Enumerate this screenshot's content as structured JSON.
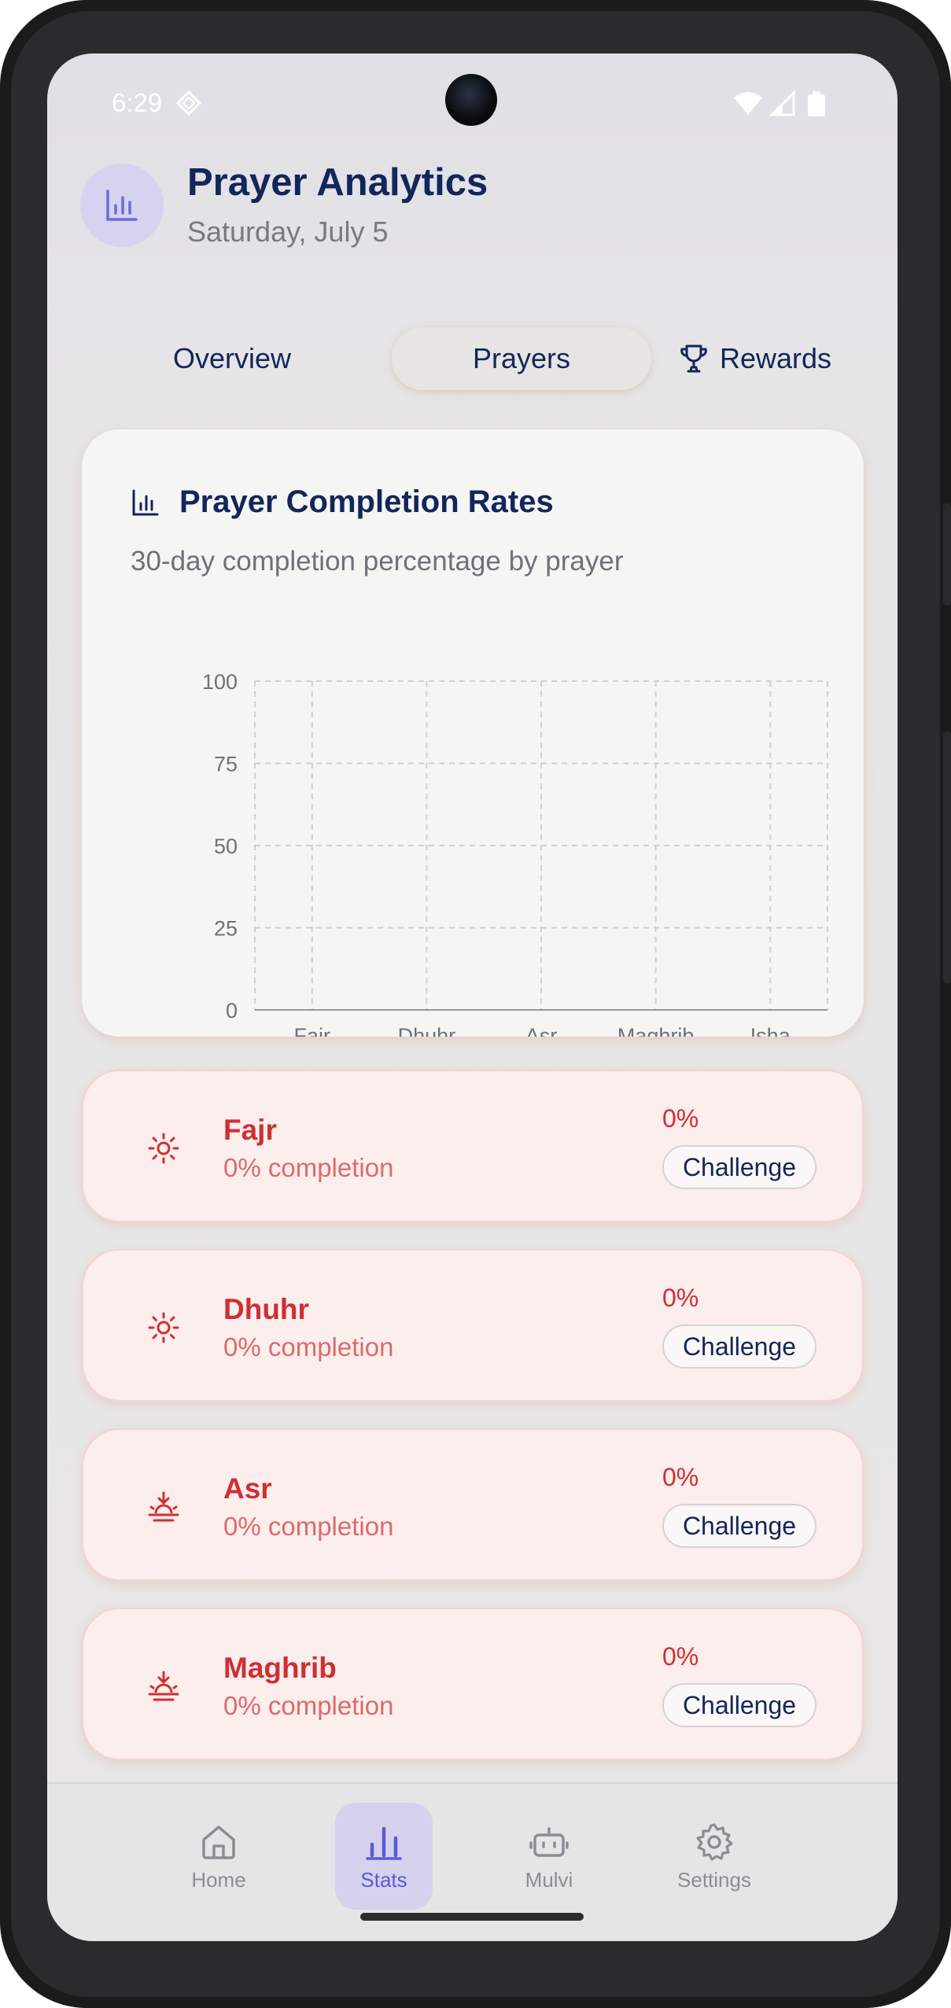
{
  "status_bar": {
    "time": "6:29"
  },
  "header": {
    "title": "Prayer Analytics",
    "subtitle": "Saturday, July 5"
  },
  "tabs": [
    {
      "label": "Overview"
    },
    {
      "label": "Prayers"
    },
    {
      "label": "Rewards"
    }
  ],
  "chart_card": {
    "title": "Prayer Completion Rates",
    "subtitle": "30-day completion percentage by prayer"
  },
  "chart_data": {
    "type": "bar",
    "categories": [
      "Fajr",
      "Dhuhr",
      "Asr",
      "Maghrib",
      "Isha"
    ],
    "values": [
      0,
      0,
      0,
      0,
      0
    ],
    "ylim": [
      0,
      100
    ],
    "yticks": [
      "0",
      "25",
      "50",
      "75",
      "100"
    ],
    "grid": true,
    "colors": {
      "grid": "#cfcfcf",
      "axis": "#9a9a9a",
      "tick_label": "#6e7178"
    }
  },
  "prayers": [
    {
      "name": "Fajr",
      "completion": "0% completion",
      "percent": "0%",
      "action": "Challenge",
      "icon": "sun-icon"
    },
    {
      "name": "Dhuhr",
      "completion": "0% completion",
      "percent": "0%",
      "action": "Challenge",
      "icon": "sun-icon"
    },
    {
      "name": "Asr",
      "completion": "0% completion",
      "percent": "0%",
      "action": "Challenge",
      "icon": "sunset-icon"
    },
    {
      "name": "Maghrib",
      "completion": "0% completion",
      "percent": "0%",
      "action": "Challenge",
      "icon": "sunset-icon"
    }
  ],
  "nav": [
    {
      "label": "Home",
      "icon": "home-icon"
    },
    {
      "label": "Stats",
      "icon": "bar-chart-icon",
      "active": true
    },
    {
      "label": "Mulvi",
      "icon": "bot-icon"
    },
    {
      "label": "Settings",
      "icon": "gear-icon"
    }
  ],
  "colors": {
    "primary_text": "#13265a",
    "accent": "#5a5ad6",
    "danger": "#cf2f33",
    "danger_light": "#fbeeed"
  }
}
